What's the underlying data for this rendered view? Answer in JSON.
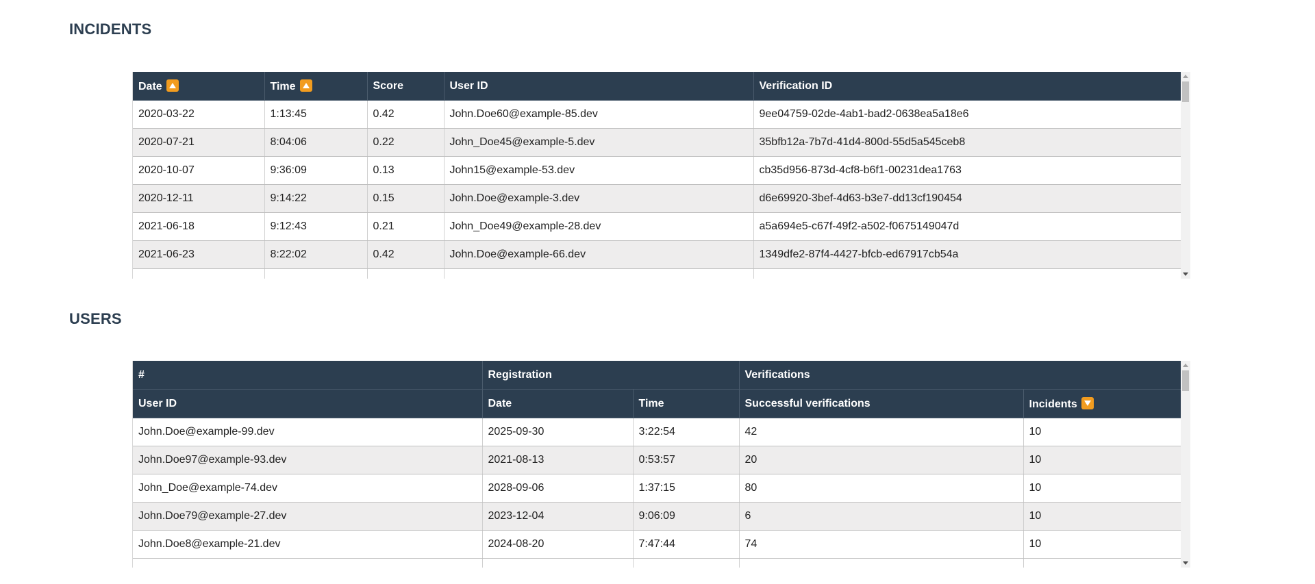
{
  "incidents": {
    "title": "INCIDENTS",
    "columns": [
      "Date",
      "Time",
      "Score",
      "User ID",
      "Verification ID"
    ],
    "sorted_columns": {
      "Date": "ascending",
      "Time": "ascending"
    },
    "rows": [
      [
        "2020-03-22",
        "1:13:45",
        "0.42",
        "John.Doe60@example-85.dev",
        "9ee04759-02de-4ab1-bad2-0638ea5a18e6"
      ],
      [
        "2020-07-21",
        "8:04:06",
        "0.22",
        "John_Doe45@example-5.dev",
        "35bfb12a-7b7d-41d4-800d-55d5a545ceb8"
      ],
      [
        "2020-10-07",
        "9:36:09",
        "0.13",
        "John15@example-53.dev",
        "cb35d956-873d-4cf8-b6f1-00231dea1763"
      ],
      [
        "2020-12-11",
        "9:14:22",
        "0.15",
        "John.Doe@example-3.dev",
        "d6e69920-3bef-4d63-b3e7-dd13cf190454"
      ],
      [
        "2021-06-18",
        "9:12:43",
        "0.21",
        "John_Doe49@example-28.dev",
        "a5a694e5-c67f-49f2-a502-f0675149047d"
      ],
      [
        "2021-06-23",
        "8:22:02",
        "0.42",
        "John.Doe@example-66.dev",
        "1349dfe2-87f4-4427-bfcb-ed67917cb54a"
      ]
    ]
  },
  "users": {
    "title": "USERS",
    "group_headers": [
      "#",
      "Registration",
      "Verifications"
    ],
    "columns": [
      "User ID",
      "Date",
      "Time",
      "Successful verifications",
      "Incidents"
    ],
    "sorted_columns": {
      "Incidents": "descending"
    },
    "rows": [
      [
        "John.Doe@example-99.dev",
        "2025-09-30",
        "3:22:54",
        "42",
        "10"
      ],
      [
        "John.Doe97@example-93.dev",
        "2021-08-13",
        "0:53:57",
        "20",
        "10"
      ],
      [
        "John_Doe@example-74.dev",
        "2028-09-06",
        "1:37:15",
        "80",
        "10"
      ],
      [
        "John.Doe79@example-27.dev",
        "2023-12-04",
        "9:06:09",
        "6",
        "10"
      ],
      [
        "John.Doe8@example-21.dev",
        "2024-08-20",
        "7:47:44",
        "74",
        "10"
      ]
    ]
  },
  "colors": {
    "header_bg": "#2c3e50",
    "title_text": "#2c3e50",
    "sort_icon": "#f29c1f",
    "row_alt": "#eeeded"
  },
  "icons": {
    "sort_ascending": "sort-ascending-icon",
    "sort_descending": "sort-descending-icon"
  }
}
